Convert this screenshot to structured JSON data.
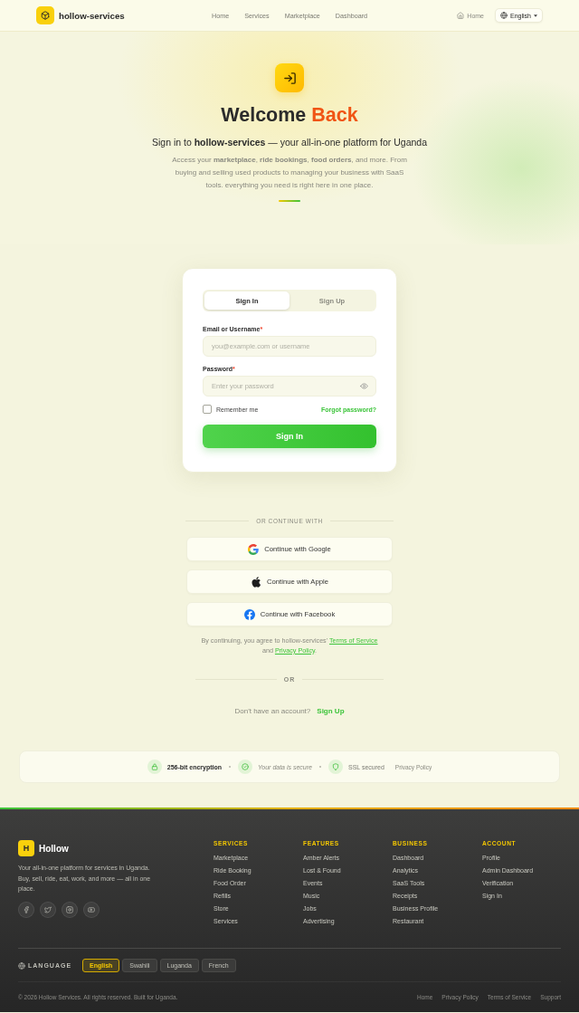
{
  "header": {
    "brand": "hollow-services",
    "nav": [
      "Home",
      "Services",
      "Marketplace",
      "Dashboard"
    ],
    "home_link": "Home",
    "language_select": "English"
  },
  "hero": {
    "title": "Welcome",
    "title_accent": "Back",
    "subtitle": "Sign in to **hollow-services** — your all-in-one platform for Uganda",
    "intro": "Access your **marketplace**, **ride bookings**, **food orders**, and more. From buying and selling used products to managing your business with SaaS tools. everything you need is right here in one place."
  },
  "auth_card": {
    "tabs": [
      {
        "label": "Sign In",
        "selected": true
      },
      {
        "label": "Sign Up",
        "selected": false
      }
    ],
    "fields": [
      {
        "kind": "text",
        "label": "Email or Username",
        "required_mark": "*",
        "placeholder": "you@example.com or username"
      },
      {
        "kind": "password",
        "label": "Password",
        "required_mark": "*",
        "placeholder": "Enter your password"
      }
    ],
    "remember": {
      "label": "Remember me",
      "checked": false
    },
    "forgot_link": "Forgot password?",
    "submit": "Sign In"
  },
  "social_login": {
    "divider_label": "OR CONTINUE WITH",
    "buttons": [
      {
        "kind": "google",
        "label": "Continue with Google"
      },
      {
        "kind": "apple",
        "label": "Continue with Apple"
      },
      {
        "kind": "facebook",
        "label": "Continue with Facebook"
      }
    ],
    "terms": {
      "before": "By continuing, you agree to hollow-services'",
      "terms_link": "Terms of Service",
      "middle": "and",
      "privacy_link": "Privacy Policy",
      "after": "."
    }
  },
  "signup": {
    "divider_label": "OR",
    "prompt": "Don't have an account?",
    "link": "Sign Up"
  },
  "security_bar": {
    "items": [
      {
        "kind": "lock",
        "label": "256-bit encryption"
      },
      {
        "kind": "check",
        "label": "Your data is secure"
      },
      {
        "kind": "shield",
        "label": "SSL secured"
      }
    ],
    "privacy_link": "Privacy Policy"
  },
  "footer": {
    "brand_mark": "H",
    "brand": "Hollow",
    "description": "Your all-in-one platform for services in Uganda. Buy, sell, ride, eat, work, and more — all in one place.",
    "social": [
      {
        "kind": "facebook"
      },
      {
        "kind": "twitter"
      },
      {
        "kind": "instagram"
      },
      {
        "kind": "youtube"
      }
    ],
    "columns": [
      {
        "title": "SERVICES",
        "links": [
          "Marketplace",
          "Ride Booking",
          "Food Order",
          "Refills",
          "Store",
          "Services"
        ]
      },
      {
        "title": "FEATURES",
        "links": [
          "Amber Alerts",
          "Lost & Found",
          "Events",
          "Music",
          "Jobs",
          "Advertising"
        ]
      },
      {
        "title": "BUSINESS",
        "links": [
          "Dashboard",
          "Analytics",
          "SaaS Tools",
          "Receipts",
          "Business Profile",
          "Restaurant"
        ]
      },
      {
        "title": "ACCOUNT",
        "links": [
          "Profile",
          "Admin Dashboard",
          "Verification",
          "Sign In"
        ]
      }
    ],
    "language_label": "LANGUAGE",
    "languages": [
      {
        "label": "English",
        "selected": true
      },
      {
        "label": "Swahili",
        "selected": false
      },
      {
        "label": "Luganda",
        "selected": false
      },
      {
        "label": "French",
        "selected": false
      }
    ],
    "copyright": "© 2026 Hollow Services. All rights reserved. Built for Uganda.",
    "bottom_links": [
      "Home",
      "Privacy Policy",
      "Terms of Service",
      "Support"
    ]
  }
}
